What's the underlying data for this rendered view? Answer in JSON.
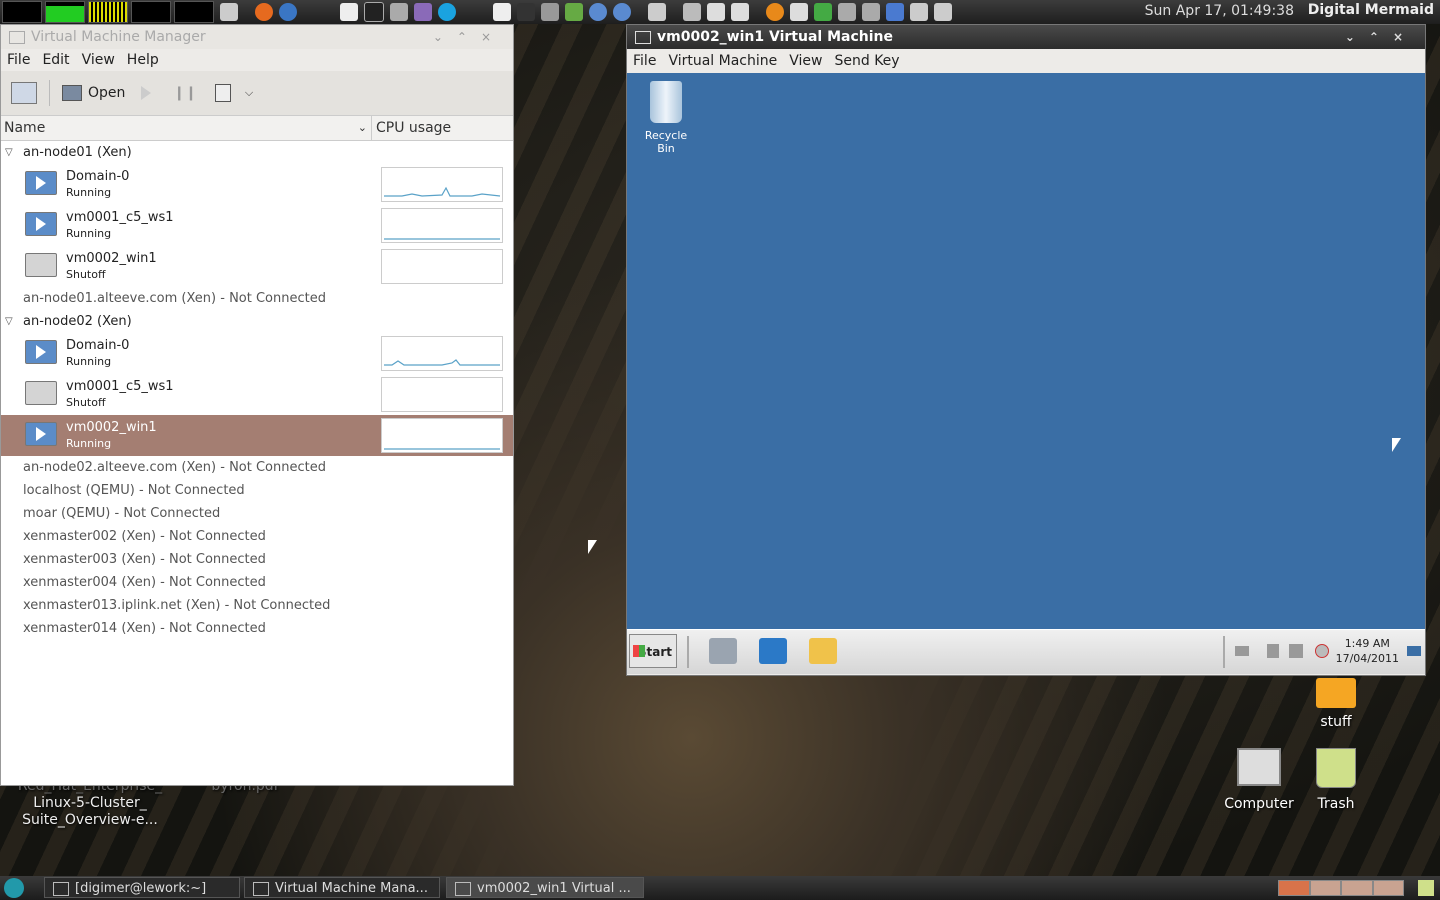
{
  "top_panel": {
    "clock": "Sun Apr 17, 01:49:38",
    "user": "Digital Mermaid"
  },
  "desktop": {
    "icons": [
      {
        "label": "stuff"
      },
      {
        "label": "Computer"
      },
      {
        "label": "Trash"
      }
    ],
    "partial_labels": [
      "Red_Hat_Enterprise_",
      "Linux-5-Cluster_",
      "Suite_Overview-e...",
      "byron.pdf"
    ]
  },
  "bottom_panel": {
    "tasks": [
      {
        "label": "[digimer@lework:~]"
      },
      {
        "label": "Virtual Machine Mana..."
      },
      {
        "label": "vm0002_win1 Virtual ..."
      }
    ]
  },
  "vmm": {
    "title": "Virtual Machine Manager",
    "menu": [
      "File",
      "Edit",
      "View",
      "Help"
    ],
    "toolbar": {
      "open_label": "Open"
    },
    "columns": {
      "name": "Name",
      "cpu": "CPU usage"
    },
    "groups": [
      {
        "label": "an-node01 (Xen)",
        "vms": [
          {
            "name": "Domain-0",
            "status": "Running"
          },
          {
            "name": "vm0001_c5_ws1",
            "status": "Running"
          },
          {
            "name": "vm0002_win1",
            "status": "Shutoff"
          }
        ]
      },
      {
        "label": "an-node02 (Xen)",
        "vms": [
          {
            "name": "Domain-0",
            "status": "Running"
          },
          {
            "name": "vm0001_c5_ws1",
            "status": "Shutoff"
          },
          {
            "name": "vm0002_win1",
            "status": "Running"
          }
        ]
      }
    ],
    "not_connected_1": "an-node01.alteeve.com (Xen) - Not Connected",
    "not_connected_rest": [
      "an-node02.alteeve.com (Xen) - Not Connected",
      "localhost (QEMU) - Not Connected",
      "moar (QEMU) - Not Connected",
      "xenmaster002 (Xen) - Not Connected",
      "xenmaster003 (Xen) - Not Connected",
      "xenmaster004 (Xen) - Not Connected",
      "xenmaster013.iplink.net (Xen) - Not Connected",
      "xenmaster014 (Xen) - Not Connected"
    ]
  },
  "vm_window": {
    "title": "vm0002_win1 Virtual Machine",
    "menu": [
      "File",
      "Virtual Machine",
      "View",
      "Send Key"
    ],
    "guest": {
      "recycle_bin": "Recycle Bin",
      "start": "Start",
      "time": "1:49 AM",
      "date": "17/04/2011"
    }
  }
}
